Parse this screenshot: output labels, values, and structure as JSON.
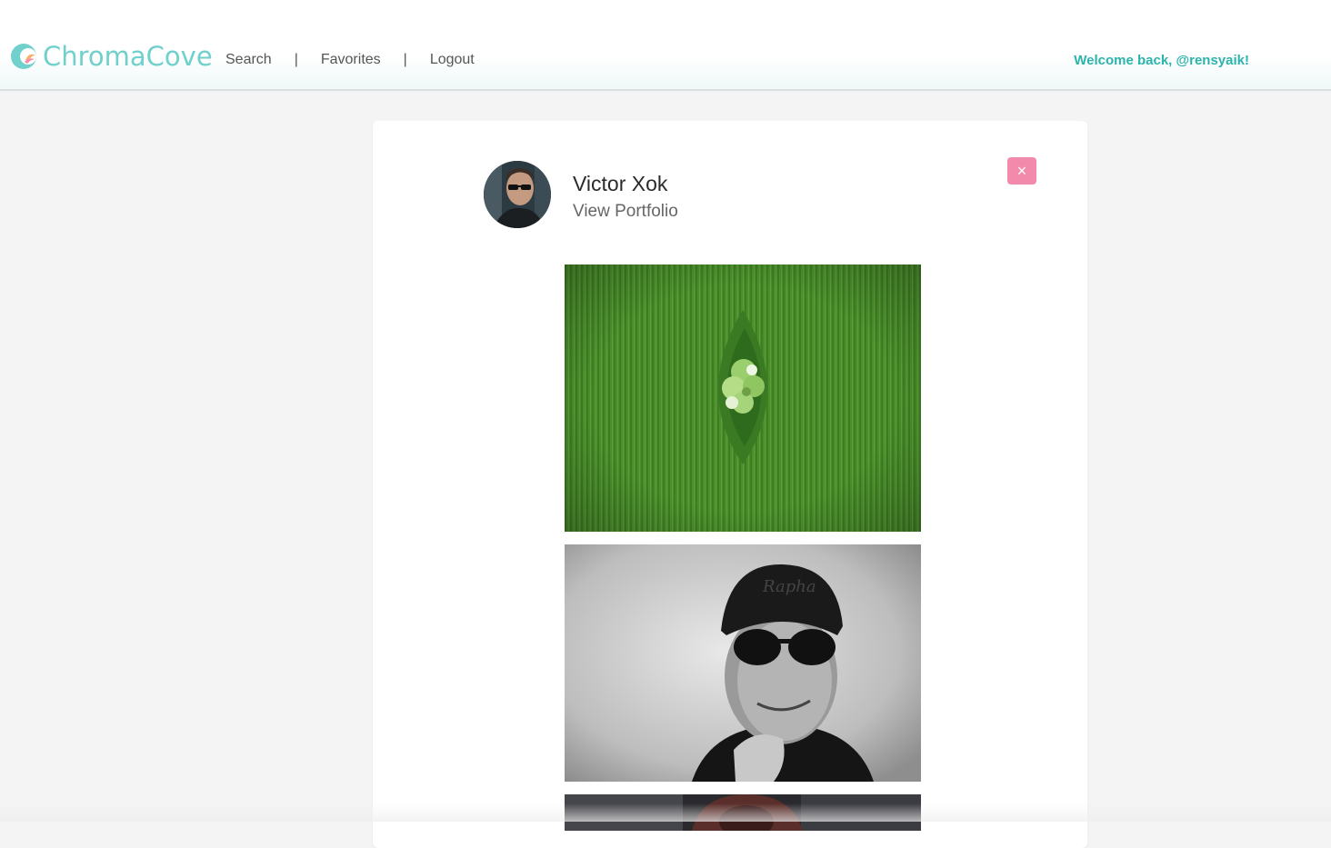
{
  "header": {
    "logo_text": "ChromaCove",
    "nav": [
      {
        "label": "Search"
      },
      {
        "label": "Favorites"
      },
      {
        "label": "Logout"
      }
    ],
    "separator": "|",
    "welcome": "Welcome back, @rensyaik!"
  },
  "modal": {
    "photographer_name": "Victor Xok",
    "portfolio_link": "View Portfolio",
    "close_icon": "×"
  },
  "colors": {
    "brand": "#6fd0cc",
    "welcome": "#2bb3ac",
    "close_button": "#f28bab"
  },
  "icons": [
    "chromacove-logo-icon",
    "close-icon"
  ]
}
